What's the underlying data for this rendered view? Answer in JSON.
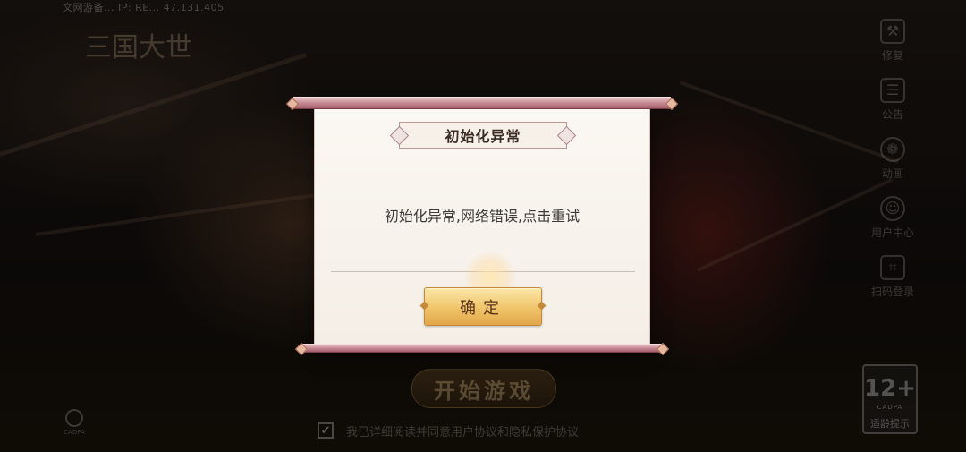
{
  "top_info": "文网游备...  IP:  RE... 47.131.405",
  "logo_text": "三国大世",
  "side_menu": [
    {
      "icon": "wrench-icon",
      "glyph": "⚒",
      "label": "修复"
    },
    {
      "icon": "notice-icon",
      "glyph": "☰",
      "label": "公告"
    },
    {
      "icon": "film-icon",
      "glyph": "❁",
      "label": "动画"
    },
    {
      "icon": "user-center-icon",
      "glyph": "☺",
      "label": "用户中心"
    },
    {
      "icon": "scan-icon",
      "glyph": "⌗",
      "label": "扫码登录"
    }
  ],
  "start_button": "开始游戏",
  "agreement": {
    "checked": "✔",
    "text": "我已详细阅读并同意用户协议和隐私保护协议"
  },
  "cadpa_label": "CADPA",
  "age_rating": {
    "age": "12+",
    "org": "CADPA",
    "tip": "适龄提示"
  },
  "dialog": {
    "title": "初始化异常",
    "message": "初始化异常,网络错误,点击重试",
    "confirm": "确定"
  }
}
